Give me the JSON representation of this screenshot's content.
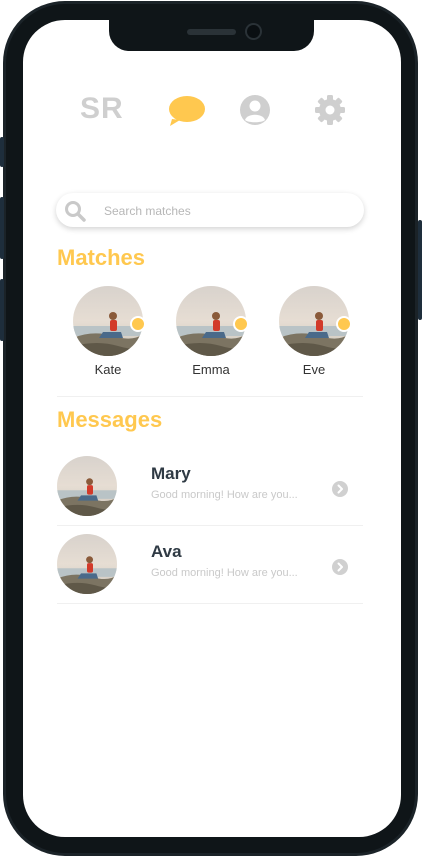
{
  "nav": {
    "logo": "SR",
    "active_color": "#ffc84f",
    "inactive_color": "#cfcfcf",
    "icons": [
      "chat-icon",
      "profile-icon",
      "settings-icon"
    ]
  },
  "search": {
    "placeholder": "Search matches"
  },
  "matches": {
    "title": "Matches",
    "items": [
      {
        "name": "Kate"
      },
      {
        "name": "Emma"
      },
      {
        "name": "Eve"
      }
    ]
  },
  "messages": {
    "title": "Messages",
    "items": [
      {
        "name": "Mary",
        "preview": "Good morning! How are you..."
      },
      {
        "name": "Ava",
        "preview": "Good morning! How are you..."
      }
    ]
  },
  "colors": {
    "accent": "#ffc84f",
    "frame": "#1b2328"
  }
}
